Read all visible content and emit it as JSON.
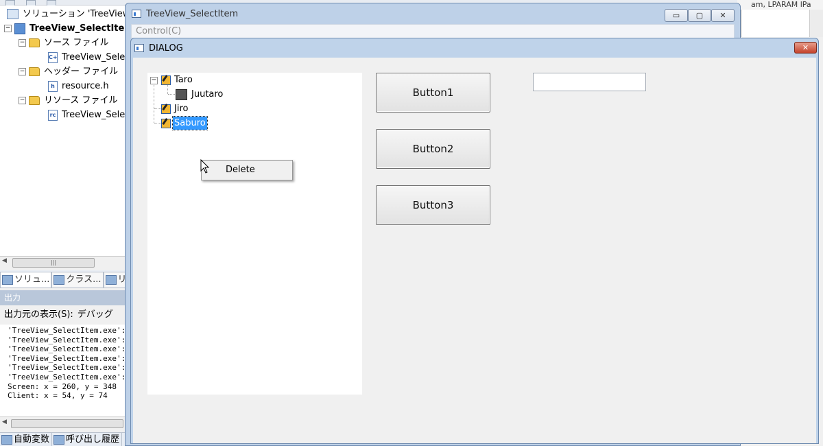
{
  "ide": {
    "solution_explorer": {
      "items": [
        {
          "label": "ソリューション 'TreeView"
        },
        {
          "label": "TreeView_SelectIte"
        },
        {
          "label": "ソース ファイル"
        },
        {
          "label": "TreeView_Sele"
        },
        {
          "label": "ヘッダー ファイル"
        },
        {
          "label": "resource.h"
        },
        {
          "label": "リソース ファイル"
        },
        {
          "label": "TreeView_Sele"
        }
      ],
      "tabs": [
        {
          "label": "ソリュ..."
        },
        {
          "label": "クラス..."
        },
        {
          "label": "リ"
        }
      ]
    },
    "output": {
      "title": "出力",
      "source_label": "出力元の表示(S):",
      "source_value": "デバッグ",
      "lines": [
        "'TreeView_SelectItem.exe':",
        "'TreeView_SelectItem.exe':",
        "'TreeView_SelectItem.exe':",
        "'TreeView_SelectItem.exe':",
        "'TreeView_SelectItem.exe':",
        "'TreeView_SelectItem.exe':",
        "Screen: x = 260, y = 348",
        "Client: x = 54, y = 74"
      ]
    },
    "bottom_tabs": [
      {
        "label": "自動変数"
      },
      {
        "label": "呼び出し履歴"
      }
    ],
    "right_header": "am, LPARAM lPa"
  },
  "main_window": {
    "title": "TreeView_SelectItem",
    "menu": {
      "control": "Control(C)"
    },
    "caption_buttons": {
      "minimize": "▭",
      "maximize": "▢",
      "close": "✕"
    }
  },
  "dialog": {
    "title": "DIALOG",
    "close_glyph": "✕",
    "tree": {
      "taro": "Taro",
      "juutaro": "Juutaro",
      "jiro": "Jiro",
      "saburo": "Saburo"
    },
    "context_menu": {
      "delete": "Delete"
    },
    "buttons": {
      "b1": "Button1",
      "b2": "Button2",
      "b3": "Button3"
    },
    "edit_value": ""
  }
}
